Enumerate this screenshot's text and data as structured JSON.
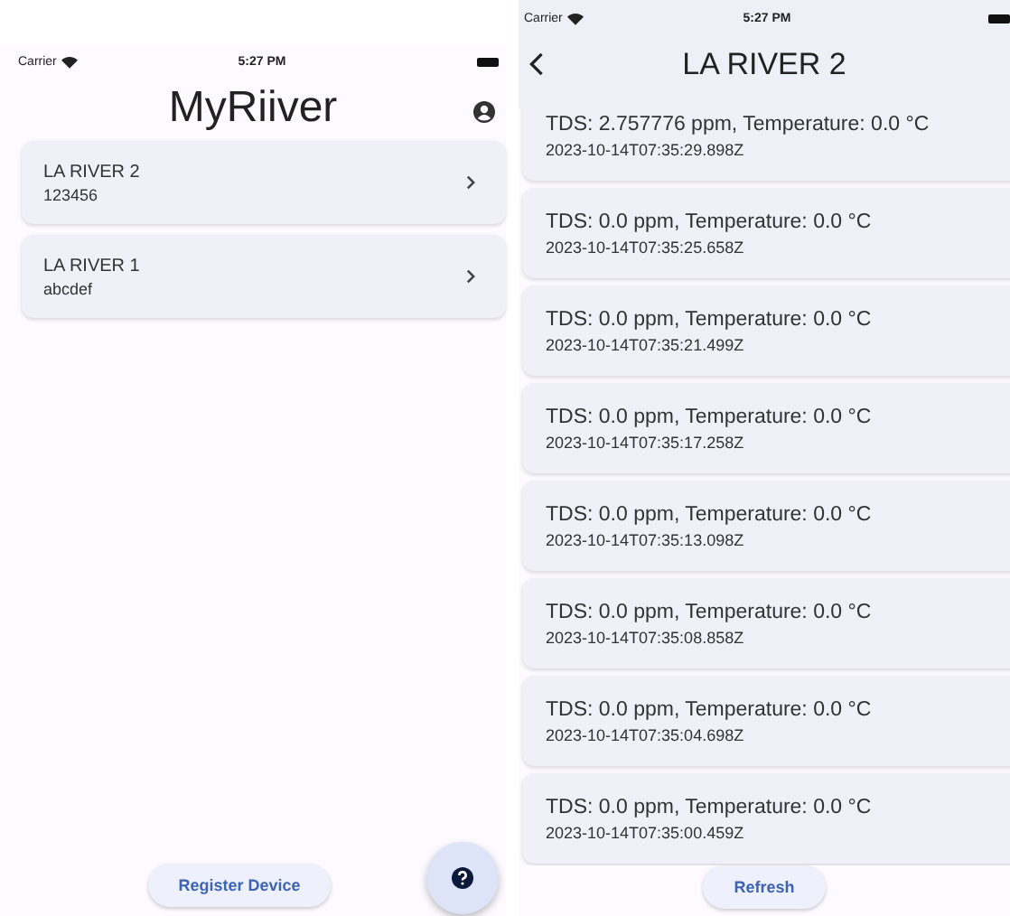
{
  "left_screen": {
    "status_bar": {
      "carrier": "Carrier",
      "time": "5:27 PM"
    },
    "title": "MyRiiver",
    "devices": [
      {
        "name": "LA RIVER 2",
        "code": "123456"
      },
      {
        "name": "LA RIVER 1",
        "code": "abcdef"
      }
    ],
    "register_button": "Register Device"
  },
  "right_screen": {
    "status_bar": {
      "carrier": "Carrier",
      "time": "5:27 PM"
    },
    "title": "LA RIVER 2",
    "readings": [
      {
        "reading": "TDS: 2.757776 ppm, Temperature: 0.0 °C",
        "timestamp": "2023-10-14T07:35:29.898Z"
      },
      {
        "reading": "TDS: 0.0 ppm, Temperature: 0.0 °C",
        "timestamp": "2023-10-14T07:35:25.658Z"
      },
      {
        "reading": "TDS: 0.0 ppm, Temperature: 0.0 °C",
        "timestamp": "2023-10-14T07:35:21.499Z"
      },
      {
        "reading": "TDS: 0.0 ppm, Temperature: 0.0 °C",
        "timestamp": "2023-10-14T07:35:17.258Z"
      },
      {
        "reading": "TDS: 0.0 ppm, Temperature: 0.0 °C",
        "timestamp": "2023-10-14T07:35:13.098Z"
      },
      {
        "reading": "TDS: 0.0 ppm, Temperature: 0.0 °C",
        "timestamp": "2023-10-14T07:35:08.858Z"
      },
      {
        "reading": "TDS: 0.0 ppm, Temperature: 0.0 °C",
        "timestamp": "2023-10-14T07:35:04.698Z"
      },
      {
        "reading": "TDS: 0.0 ppm, Temperature: 0.0 °C",
        "timestamp": "2023-10-14T07:35:00.459Z"
      }
    ],
    "refresh_button": "Refresh"
  }
}
